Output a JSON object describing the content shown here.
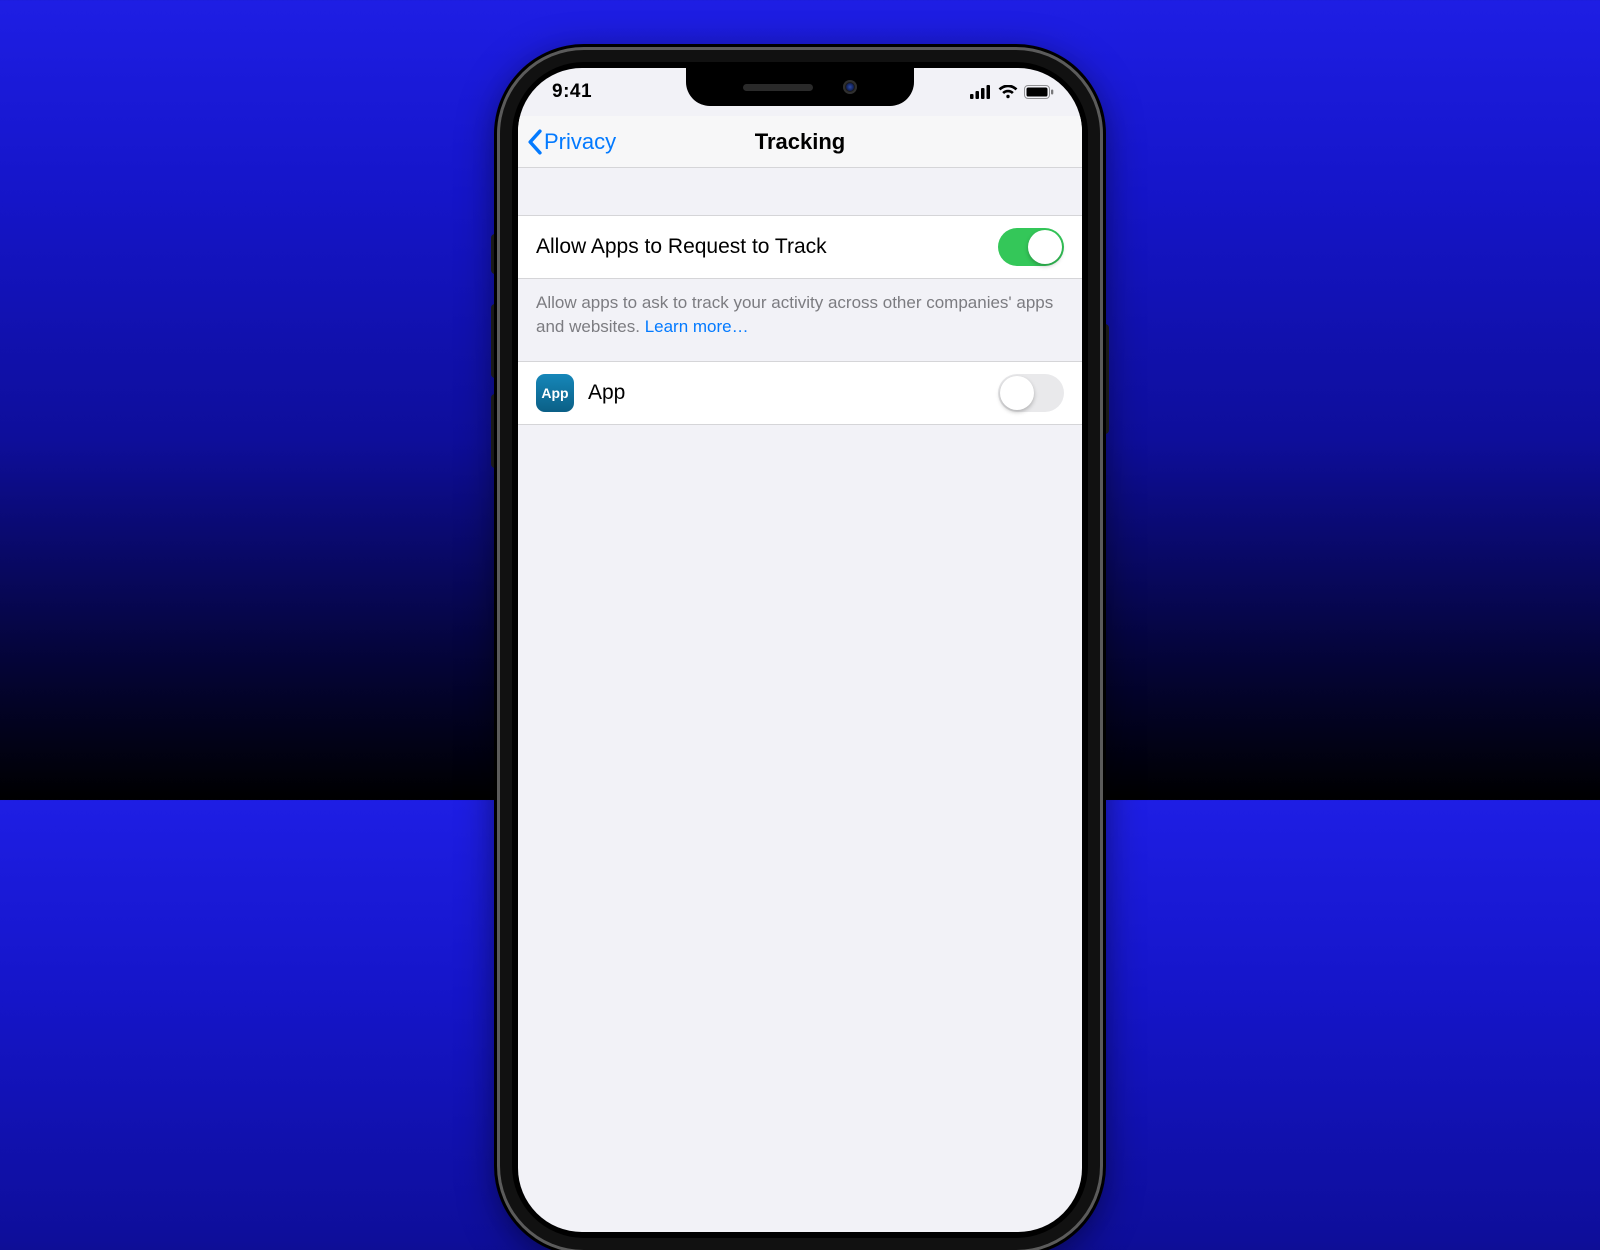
{
  "colors": {
    "accent": "#037aff",
    "toggle_on": "#34c759",
    "link": "#037aff"
  },
  "statusbar": {
    "time": "9:41"
  },
  "nav": {
    "back_label": "Privacy",
    "title": "Tracking"
  },
  "rows": {
    "allow": {
      "label": "Allow Apps to Request to Track",
      "toggle_on": true
    },
    "footer": {
      "text": "Allow apps to ask to track your activity across other companies' apps and websites. ",
      "link_label": "Learn more…"
    },
    "app": {
      "icon_text": "App",
      "label": "App",
      "toggle_on": false
    }
  }
}
